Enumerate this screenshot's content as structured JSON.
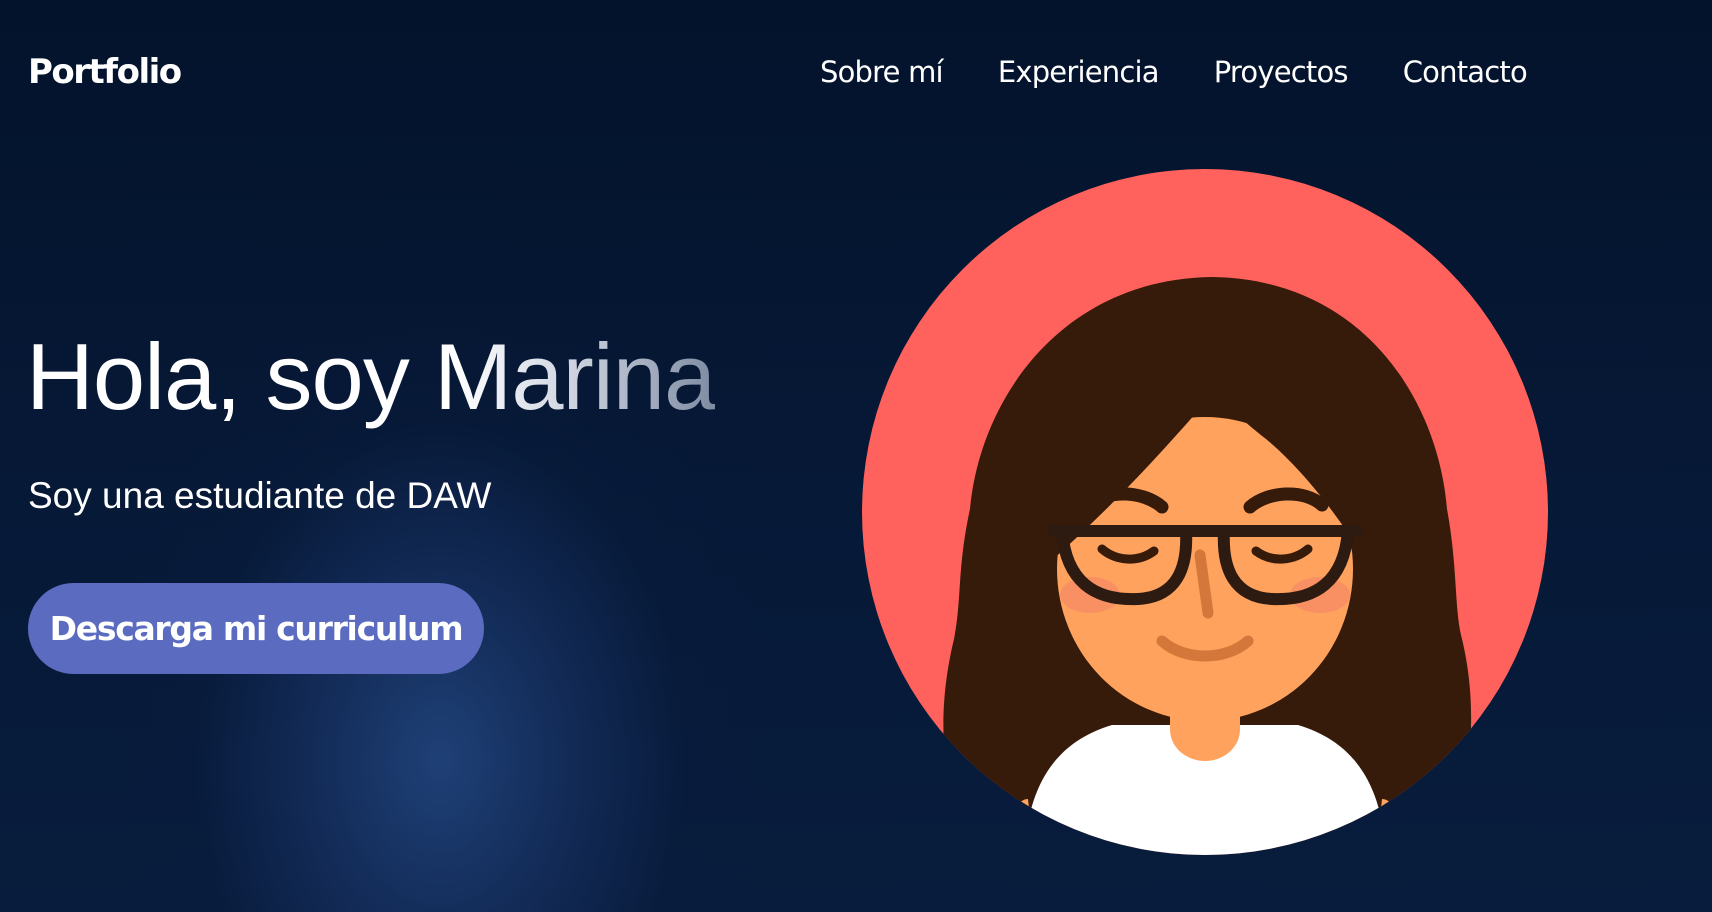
{
  "header": {
    "logo": "Portfolio",
    "nav": [
      {
        "label": "Sobre mí"
      },
      {
        "label": "Experiencia"
      },
      {
        "label": "Proyectos"
      },
      {
        "label": "Contacto"
      }
    ]
  },
  "hero": {
    "title": "Hola, soy Marina",
    "subtitle": "Soy una estudiante de DAW",
    "cta_label": "Descarga mi curriculum"
  },
  "avatar": {
    "icon": "girl-with-glasses-avatar",
    "colors": {
      "circle": "#ff625c",
      "hair": "#361a0a",
      "skin": "#ffa25d",
      "glasses": "#2d1a10",
      "shirt": "#ffffff"
    }
  },
  "colors": {
    "background": "#04132d",
    "button": "#5b6cc0",
    "text": "#ffffff"
  }
}
